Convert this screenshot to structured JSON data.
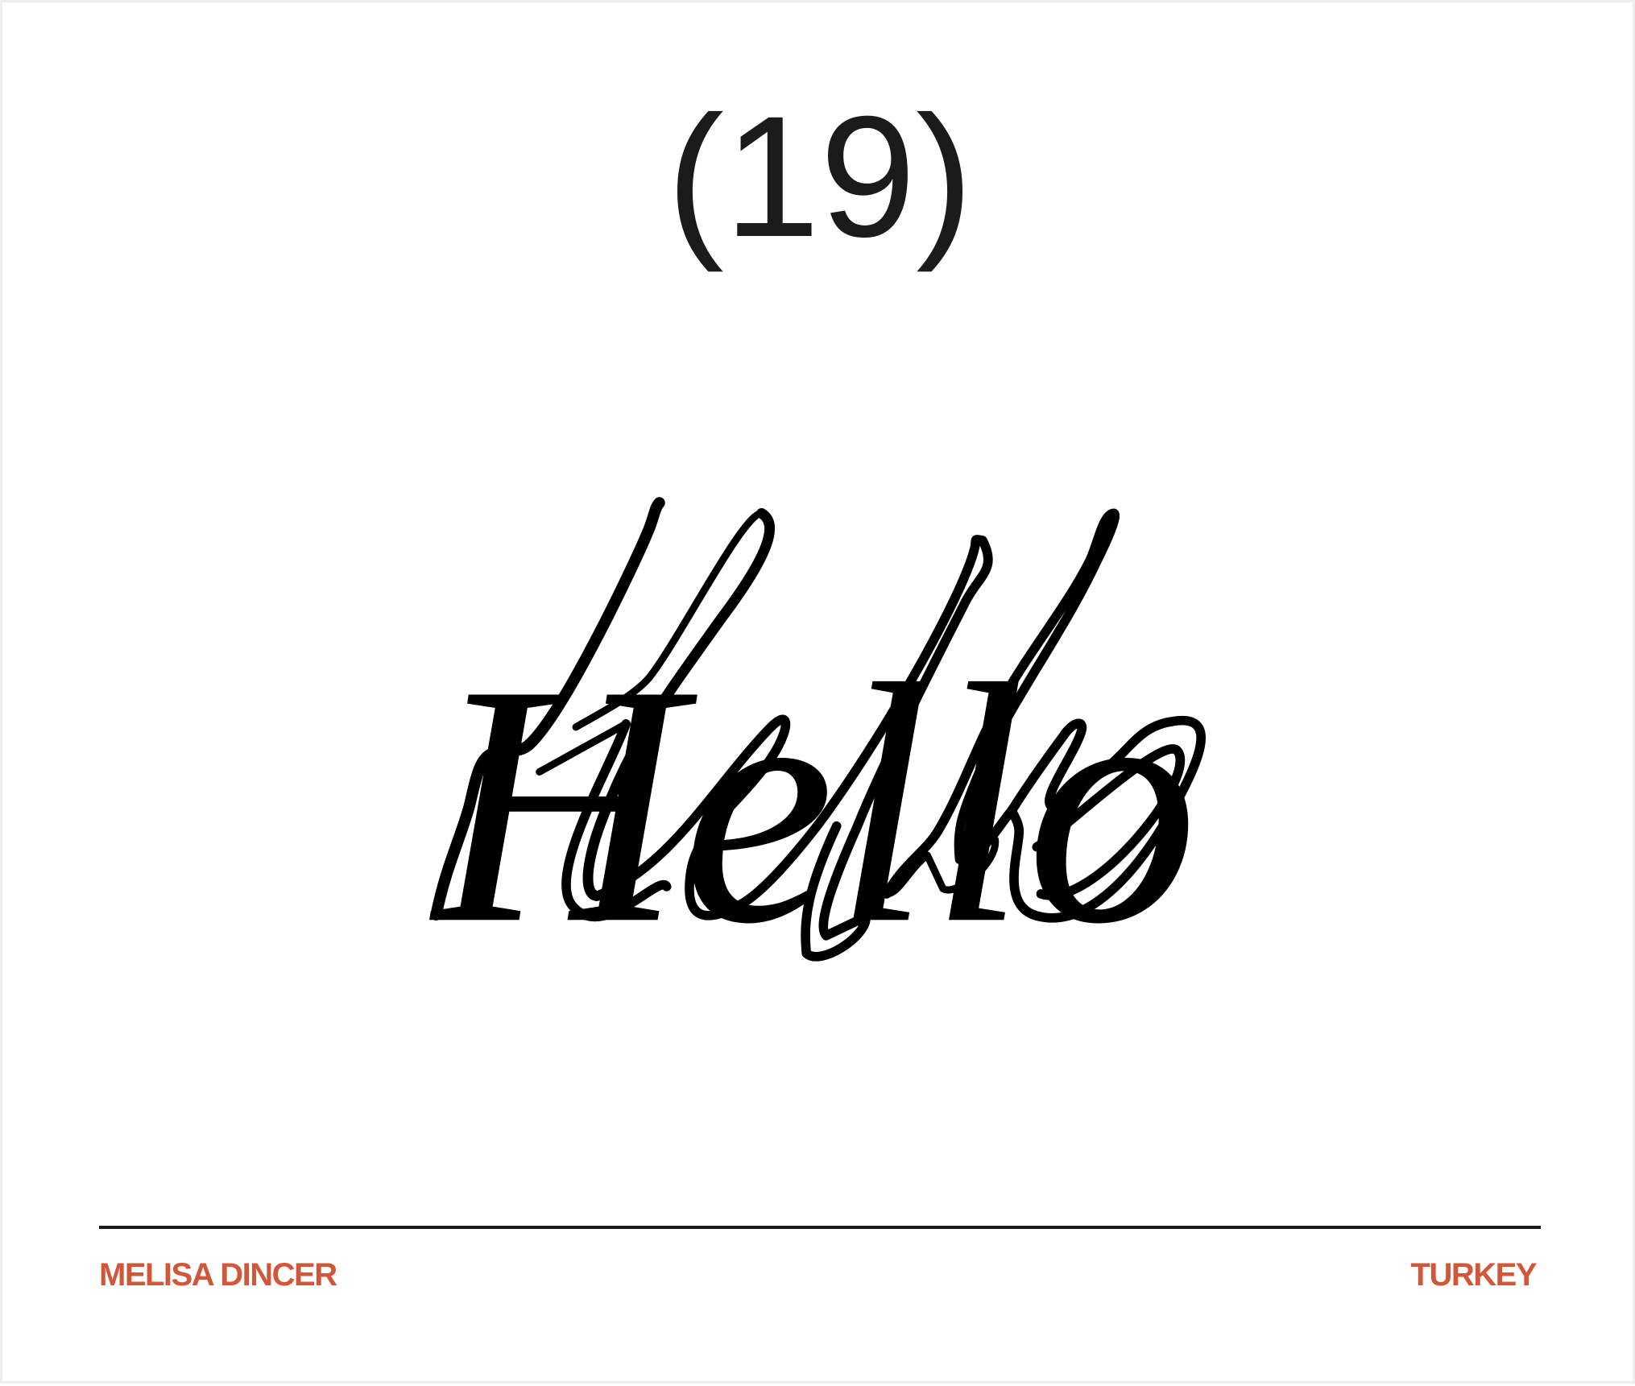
{
  "number_label": "(19)",
  "artwork": {
    "word": "Hello",
    "style": "handwritten-script",
    "ink_color": "#000000"
  },
  "footer": {
    "name": "MELISA DINCER",
    "country": "TURKEY"
  },
  "colors": {
    "accent": "#d0573a",
    "text": "#1b1b1b",
    "rule": "#1b1b1b"
  }
}
